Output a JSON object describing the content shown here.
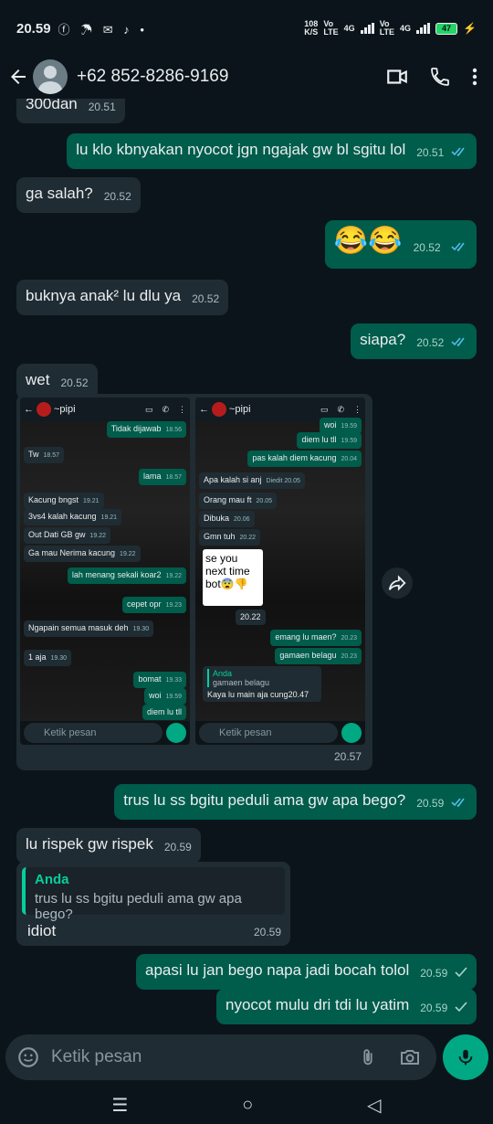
{
  "status_bar": {
    "time": "20.59",
    "left_icons": "ⓕ ☂ ✉ ♪ •",
    "speed": "108\nK/S",
    "net1": "Vo\nLTE",
    "net2": "4G",
    "net3": "Vo\nLTE",
    "net4": "4G",
    "battery": "47"
  },
  "header": {
    "contact": "+62 852-8286-9169"
  },
  "messages": [
    {
      "text": "300dan",
      "time": "20.51"
    },
    {
      "text": "lu klo kbnyakan nyocot jgn ngajak gw bl sgitu lol",
      "time": "20.51"
    },
    {
      "text": "ga salah?",
      "time": "20.52"
    },
    {
      "text": "😂😂",
      "time": "20.52"
    },
    {
      "text": "buknya anak² lu dlu ya",
      "time": "20.52"
    },
    {
      "text": "siapa?",
      "time": "20.52"
    },
    {
      "text": "wet",
      "time": "20.52"
    },
    {
      "text": "trus lu ss bgitu peduli ama gw apa bego?",
      "time": "20.59"
    },
    {
      "text": "lu rispek gw rispek",
      "time": "20.59"
    },
    {
      "text": "apasi lu jan bego napa jadi bocah tolol",
      "time": "20.59"
    },
    {
      "text": "nyocot mulu dri tdi lu yatim",
      "time": "20.59"
    }
  ],
  "media": {
    "time": "20.57",
    "shot1": {
      "title": "~pipi",
      "bubbles": [
        {
          "text": "Tidak dijawab",
          "time": "18.56"
        },
        {
          "text": "Tw",
          "time": "18.57"
        },
        {
          "text": "lama",
          "time": "18.57"
        },
        {
          "text": "Kacung bngst",
          "time": "19.21"
        },
        {
          "text": "3vs4 kalah kacung",
          "time": "19.21"
        },
        {
          "text": "Out Dati GB gw",
          "time": "19.22"
        },
        {
          "text": "Ga mau Nerima kacung",
          "time": "19.22"
        },
        {
          "text": "lah menang sekali koar2",
          "time": "19.22"
        },
        {
          "text": "cepet opr",
          "time": "19.23"
        },
        {
          "text": "Ngapain semua masuk deh",
          "time": "19.30"
        },
        {
          "text": "1 aja",
          "time": "19.30"
        },
        {
          "text": "bomat",
          "time": "19.33"
        },
        {
          "text": "woi",
          "time": "19.59"
        },
        {
          "text": "diem lu tll",
          "time": ""
        }
      ],
      "input": "Ketik pesan"
    },
    "shot2": {
      "title": "~pipi",
      "bubbles": [
        {
          "text": "woi",
          "time": "19.59"
        },
        {
          "text": "diem lu tll",
          "time": "19.59"
        },
        {
          "text": "pas kalah diem kacung",
          "time": "20.04"
        },
        {
          "text": "Apa kalah si anj",
          "time": "Diedit 20.05"
        },
        {
          "text": "Orang mau ft",
          "time": "20.05"
        },
        {
          "text": "Dibuka",
          "time": "20.06"
        },
        {
          "text": "Gmn tuh",
          "time": "20.22"
        },
        {
          "text": "20.22",
          "time": ""
        },
        {
          "text": "emang lu maen?",
          "time": "20.23"
        },
        {
          "text": "gamaen belagu",
          "time": "20.23"
        },
        {
          "text": "Kaya lu main aja cung",
          "time": "20.47"
        }
      ],
      "sticker": "se you next time bot😨👎",
      "quote_author": "Anda",
      "quote_text": "gamaen belagu",
      "input": "Ketik pesan"
    }
  },
  "quoted_reply": {
    "author": "Anda",
    "quoted": "trus lu ss bgitu peduli ama gw apa bego?",
    "reply": "idiot",
    "time": "20.59"
  },
  "composer": {
    "placeholder": "Ketik pesan"
  }
}
